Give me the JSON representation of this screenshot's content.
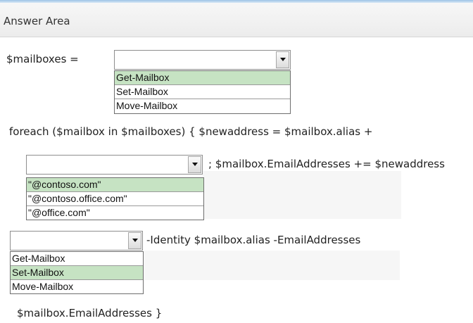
{
  "header": {
    "title": "Answer Area"
  },
  "code": {
    "line1": "$mailboxes =",
    "line2": "foreach ($mailbox in $mailboxes) { $newaddress = $mailbox.alias +",
    "line3": "; $mailbox.EmailAddresses += $newaddress",
    "line4": "-Identity $mailbox.alias -EmailAddresses",
    "line5": "$mailbox.EmailAddresses }"
  },
  "dropdown1": {
    "value": "",
    "options": [
      {
        "label": "Get-Mailbox",
        "highlighted": true
      },
      {
        "label": "Set-Mailbox",
        "highlighted": false
      },
      {
        "label": "Move-Mailbox",
        "highlighted": false
      }
    ]
  },
  "dropdown2": {
    "value": "",
    "options": [
      {
        "label": "\"@contoso.com\"",
        "highlighted": true
      },
      {
        "label": "\"@contoso.office.com\"",
        "highlighted": false
      },
      {
        "label": "\"@office.com\"",
        "highlighted": false
      }
    ]
  },
  "dropdown3": {
    "value": "",
    "options": [
      {
        "label": "Get-Mailbox",
        "highlighted": false
      },
      {
        "label": "Set-Mailbox",
        "highlighted": true
      },
      {
        "label": "Move-Mailbox",
        "highlighted": false
      }
    ]
  },
  "colors": {
    "highlight": "#c6e3c3",
    "header_bg": "#ececec",
    "top_bar": "#9ec3e6"
  }
}
